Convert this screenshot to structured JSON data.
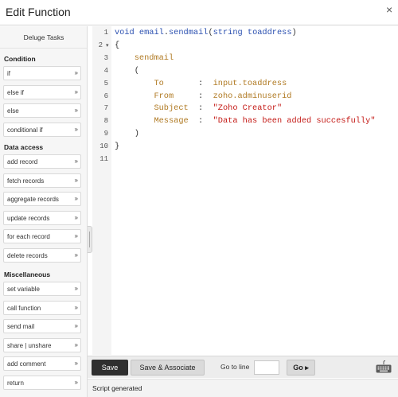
{
  "window": {
    "title": "Edit Function",
    "close_glyph": "×"
  },
  "sidebar": {
    "header": "Deluge Tasks",
    "arrow_glyph": "»",
    "sections": [
      {
        "title": "Condition",
        "items": [
          "if",
          "else if",
          "else",
          "conditional if"
        ]
      },
      {
        "title": "Data access",
        "items": [
          "add record",
          "fetch records",
          "aggregate records",
          "update records",
          "for each record",
          "delete records"
        ]
      },
      {
        "title": "Miscellaneous",
        "items": [
          "set variable",
          "call function",
          "send mail",
          "share | unshare",
          "add comment",
          "return"
        ]
      }
    ]
  },
  "editor": {
    "line_numbers": [
      "1",
      "2",
      "3",
      "4",
      "5",
      "6",
      "7",
      "8",
      "9",
      "10",
      "11"
    ],
    "fold_glyph": "▾",
    "lines": [
      [
        {
          "t": "void",
          "c": "kw"
        },
        {
          "t": " ",
          "c": "pl"
        },
        {
          "t": "email",
          "c": "nm"
        },
        {
          "t": ".",
          "c": "pl"
        },
        {
          "t": "sendmail",
          "c": "nm"
        },
        {
          "t": "(",
          "c": "pl"
        },
        {
          "t": "string",
          "c": "kw"
        },
        {
          "t": " ",
          "c": "pl"
        },
        {
          "t": "toaddress",
          "c": "nm"
        },
        {
          "t": ")",
          "c": "pl"
        }
      ],
      [
        {
          "t": "{",
          "c": "pl"
        }
      ],
      [
        {
          "t": "    ",
          "c": "pl"
        },
        {
          "t": "sendmail",
          "c": "tl"
        }
      ],
      [
        {
          "t": "    (",
          "c": "pl"
        }
      ],
      [
        {
          "t": "        ",
          "c": "pl"
        },
        {
          "t": "To",
          "c": "tl"
        },
        {
          "t": "       :  ",
          "c": "pl"
        },
        {
          "t": "input.toaddress",
          "c": "tl"
        }
      ],
      [
        {
          "t": "        ",
          "c": "pl"
        },
        {
          "t": "From",
          "c": "tl"
        },
        {
          "t": "     :  ",
          "c": "pl"
        },
        {
          "t": "zoho.adminuserid",
          "c": "tl"
        }
      ],
      [
        {
          "t": "        ",
          "c": "pl"
        },
        {
          "t": "Subject",
          "c": "tl"
        },
        {
          "t": "  :  ",
          "c": "pl"
        },
        {
          "t": "\"Zoho Creator\"",
          "c": "st"
        }
      ],
      [
        {
          "t": "        ",
          "c": "pl"
        },
        {
          "t": "Message",
          "c": "tl"
        },
        {
          "t": "  :  ",
          "c": "pl"
        },
        {
          "t": "\"Data has been added succesfully\"",
          "c": "st"
        }
      ],
      [
        {
          "t": "    )",
          "c": "pl"
        }
      ],
      [
        {
          "t": "}",
          "c": "pl"
        }
      ],
      []
    ]
  },
  "footer": {
    "save_label": "Save",
    "save_associate_label": "Save & Associate",
    "goto_label": "Go to line",
    "goto_value": "",
    "go_label": "Go ▸",
    "keyboard_icon": "keyboard-icon"
  },
  "status": {
    "message": "Script generated"
  }
}
